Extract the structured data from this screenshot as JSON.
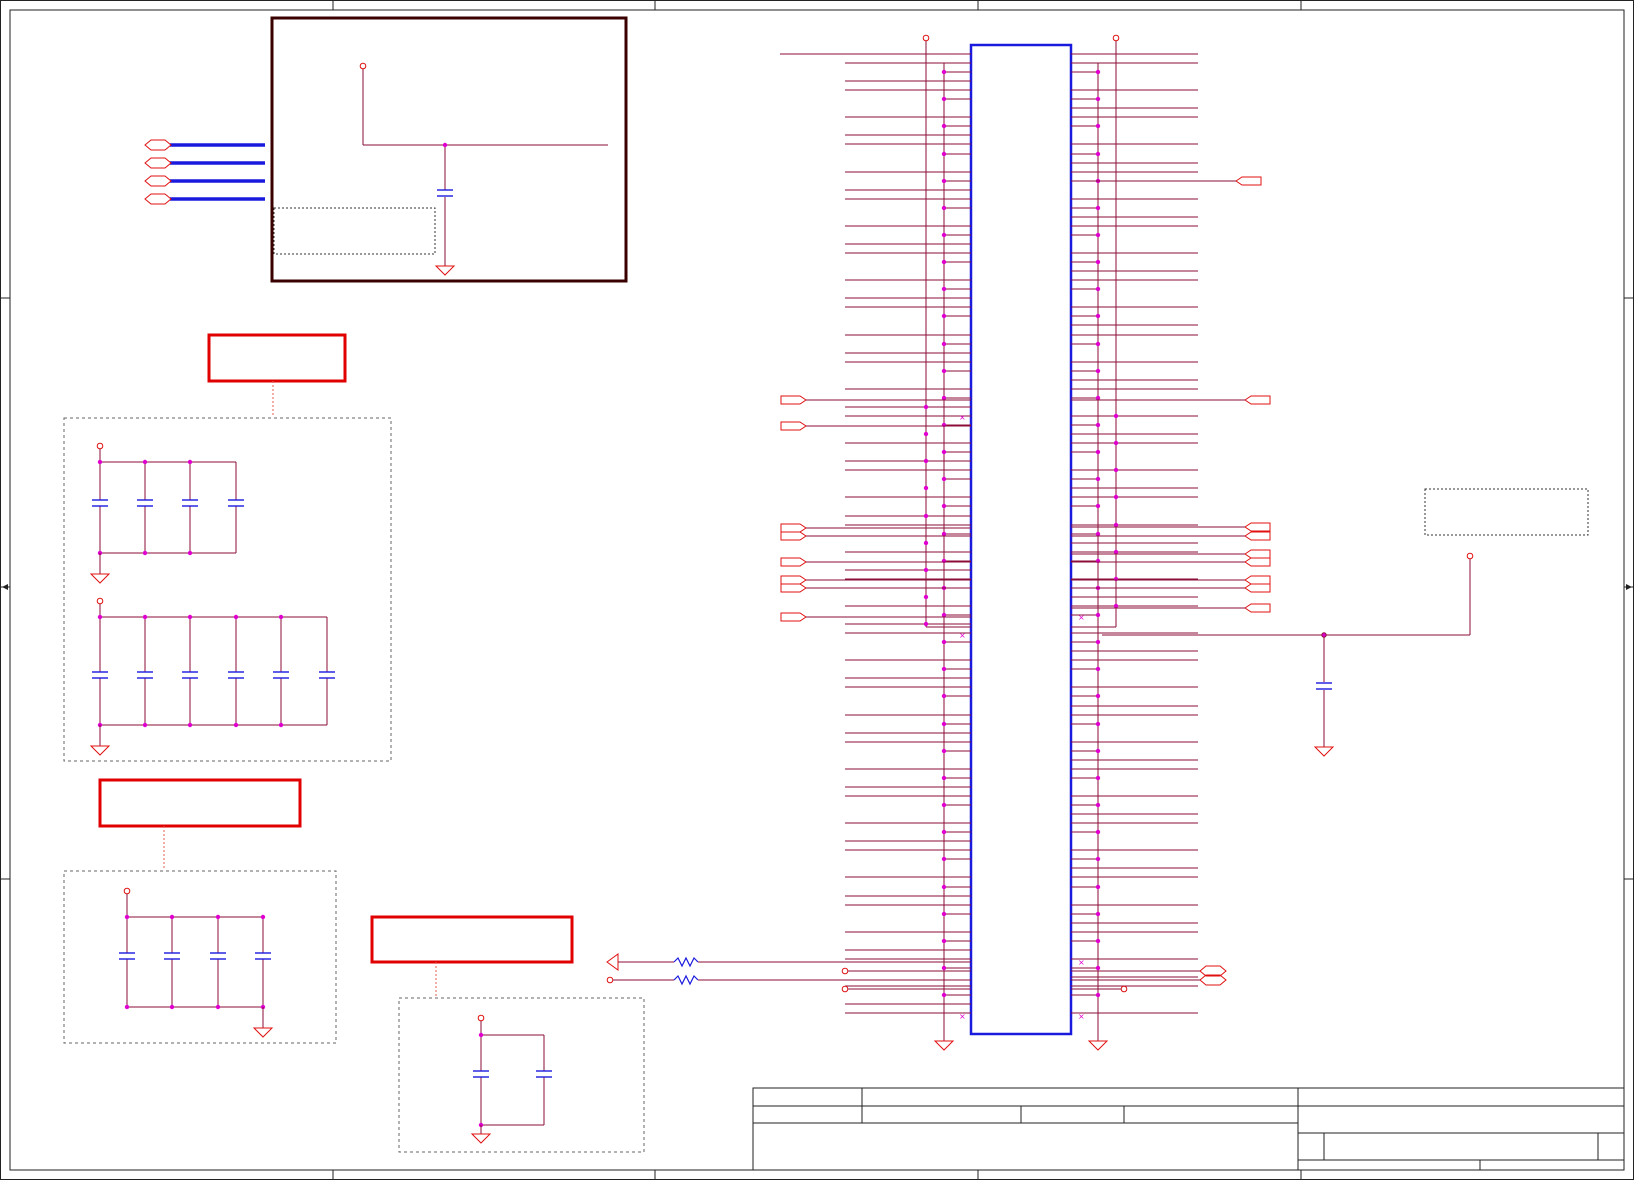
{
  "diagram": {
    "kind": "electrical-schematic",
    "colors": {
      "wire": "#8b0e3a",
      "junction": "#e000d0",
      "component": "#1a1adf",
      "power_symbol": "#e01010",
      "box_outline": "#e00000",
      "frame": "#222222",
      "dark_box": "#3a0000",
      "note_box": "#666666"
    },
    "components": {
      "connector": "large-multi-pin-connector",
      "capacitor_groups": 4,
      "resistors": 2,
      "off_page_connectors": 22
    },
    "title_block": {
      "present": true,
      "text": []
    }
  }
}
